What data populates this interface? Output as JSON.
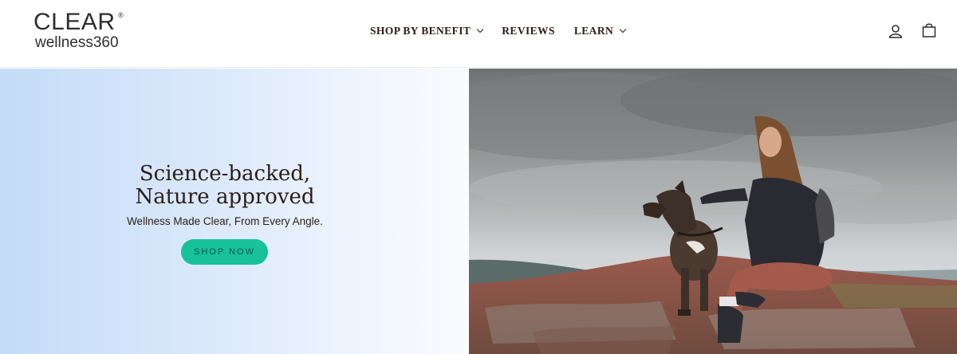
{
  "brand": {
    "name": "CLEAR",
    "registered": "®",
    "tagline": "wellness360"
  },
  "nav": {
    "items": [
      {
        "label": "SHOP BY BENEFIT",
        "has_dropdown": true
      },
      {
        "label": "REVIEWS",
        "has_dropdown": false
      },
      {
        "label": "LEARN",
        "has_dropdown": true
      }
    ]
  },
  "header_icons": [
    "account-icon",
    "shopping-bag-icon"
  ],
  "hero": {
    "headline_line1": "Science-backed,",
    "headline_line2": "Nature approved",
    "subheadline": "Wellness Made Clear, From Every Angle.",
    "cta_label": "SHOP NOW",
    "image_subject": "woman-and-dog-on-mountain-top"
  },
  "colors": {
    "cta_bg": "#17c19a",
    "text_dark": "#2b1d17",
    "gradient_left": "#c4dcf8",
    "gradient_right": "#f9fbff"
  }
}
